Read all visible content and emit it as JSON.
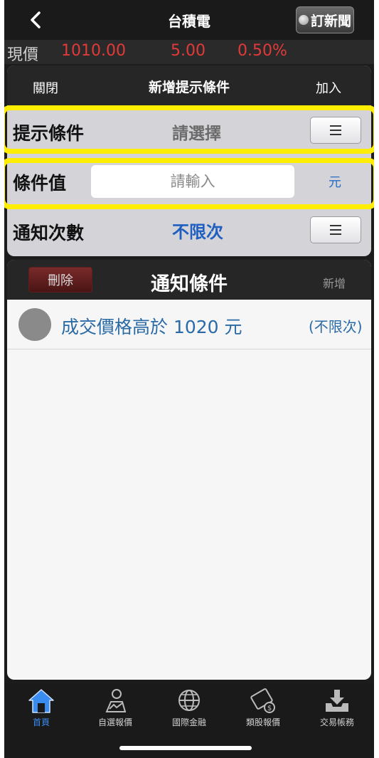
{
  "header": {
    "back_icon": "chevron-left-icon",
    "title": "台積電",
    "news_button": "訂新聞",
    "news_icon": "check-circle-icon"
  },
  "quote": {
    "label": "現價",
    "price": "1010.00",
    "change": "5.00",
    "percent": "0.50%",
    "up_color": "#e23a3a"
  },
  "condition_panel": {
    "close": "關閉",
    "title": "新增提示條件",
    "add": "加入",
    "rows": [
      {
        "label": "提示條件",
        "value": "請選擇",
        "button_icon": "menu-icon"
      },
      {
        "label": "條件值",
        "placeholder": "請輸入",
        "unit": "元"
      },
      {
        "label": "通知次數",
        "value": "不限次",
        "button_icon": "menu-icon"
      }
    ]
  },
  "notify_panel": {
    "delete": "刪除",
    "title": "通知條件",
    "add": "新增",
    "items": [
      {
        "text": "成交價格高於 1020 元",
        "count": "(不限次)"
      }
    ]
  },
  "tabs": [
    {
      "label": "首頁",
      "icon": "home-icon",
      "active": true
    },
    {
      "label": "自選報價",
      "icon": "person-chart-icon",
      "active": false
    },
    {
      "label": "國際金融",
      "icon": "globe-icon",
      "active": false
    },
    {
      "label": "類股報價",
      "icon": "film-coin-icon",
      "active": false
    },
    {
      "label": "交易帳務",
      "icon": "download-tray-icon",
      "active": false
    }
  ],
  "colors": {
    "accent": "#3a8cf0",
    "highlight": "#ffee00",
    "link": "#2a6aa6"
  }
}
